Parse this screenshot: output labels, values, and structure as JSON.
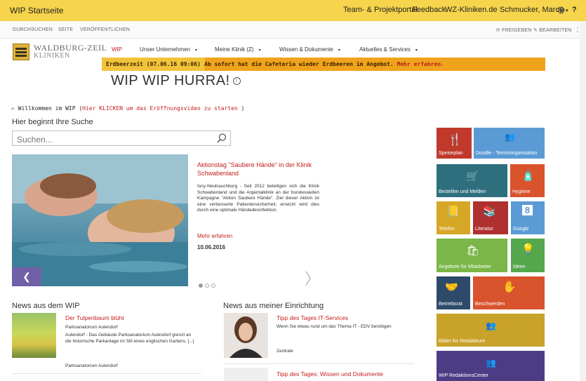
{
  "topbar": {
    "title": "WIP Startseite",
    "links": [
      "Team- & Projektportal",
      "Feedback",
      "WZ-Kliniken.de"
    ],
    "user": "Schmucker, Marco",
    "user_caret": "▾",
    "help": "?"
  },
  "ribbon": {
    "left": [
      "DURCHSUCHEN",
      "SEITE",
      "VERÖFFENTLICHEN"
    ],
    "share": "FREIGEBEN",
    "edit": "BEARBEITEN"
  },
  "logo": {
    "name": "WALDBURG-ZEIL",
    "sub": "KLINIKEN"
  },
  "nav": {
    "items": [
      "WIP",
      "Unser Unternehmen",
      "Meine Klinik (Z)",
      "Wissen & Dokumente",
      "Aktuelles & Services"
    ],
    "caret": "▾"
  },
  "announce": {
    "date": "Erdbeerzeit (07.06.16 09:06)",
    "message": "Ab sofort hat die Cafeteria wieder Erdbeeren im Angebot.",
    "more": "Mehr erfahren."
  },
  "page": {
    "title": "WIP WIP HURRA!",
    "info_icon": "i"
  },
  "welcome": {
    "text": "Willkommen im WIP (",
    "link": "Hier KLICKEN um das Eröffnungsvideo zu starten",
    "close": " )"
  },
  "search": {
    "heading": "Hier beginnt Ihre Suche",
    "placeholder": "Suchen..."
  },
  "carousel": {
    "prev": "❮",
    "next": "〉",
    "article": {
      "title": "Aktionstag \"Saubere Hände\" in der Klinik Schwabenland",
      "body": "Isny-Neutrauchburg - Seit 2012 beteiligen sich die Klinik Schwabenland und die Argentalklinik an der bundesweiten Kampagne \"Aktion Saubere Hände\". Ziel dieser Aktion ist eine verbesserte Patientensicherheit, erreicht wird dies durch eine optimale Händedesinfektion.",
      "more": "Mehr erfahren",
      "date": "10.06.2016"
    }
  },
  "news_wip": {
    "heading": "News aus dem WIP",
    "items": [
      {
        "title": "Der Tulpenbaum blüht",
        "location": "Parksanatorium Aulendorf",
        "text": "Aulendorf - Das Gebäude Parksanatorium Aulendorf grenzt an die historische Parkanlage im Stil eines englischen Gartens, [...]",
        "footer": "Parksanatorium Aulendorf"
      }
    ]
  },
  "news_facility": {
    "heading": "News aus meiner Einrichtung",
    "items": [
      {
        "title": "Tipp des Tages IT-Services",
        "text": "Wenn Sie etwas rund um das Thema IT - EDV benötigen",
        "footer": "Zentrale"
      },
      {
        "title": "Tipp des Tages: Wissen und Dokumente"
      }
    ]
  },
  "tiles": [
    {
      "label": "Speiseplan",
      "color": "#c0392b",
      "icon": "fork-knife-icon"
    },
    {
      "label": "Doodle - Terminorganisation",
      "color": "#5b9bd5",
      "icon": "people-icon"
    },
    {
      "label": "Bestellen und Melden",
      "color": "#2e6f7e",
      "icon": "cart-icon"
    },
    {
      "label": "Hygiene",
      "color": "#d9532c",
      "icon": "hygiene-icon"
    },
    {
      "label": "Telefon",
      "color": "#d6a726",
      "icon": "phone-book-icon"
    },
    {
      "label": "Literatur",
      "color": "#b03030",
      "icon": "books-icon"
    },
    {
      "label": "Google",
      "color": "#5b9bd5",
      "icon": "google-icon"
    },
    {
      "label": "Angebote für Mitarbeiter",
      "color": "#7ab648",
      "icon": "bag-icon"
    },
    {
      "label": "Ideen",
      "color": "#55a74c",
      "icon": "bulb-icon"
    },
    {
      "label": "Betriebsrat",
      "color": "#2e4a6b",
      "icon": "handshake-icon"
    },
    {
      "label": "Beschwerden",
      "color": "#d9532c",
      "icon": "hand-icon"
    },
    {
      "label": "Bilder für Redakteure",
      "color": "#c9a22a",
      "icon": "people-icon"
    },
    {
      "label": "WIP RedaktionsCenter",
      "color": "#4b3c84",
      "icon": "people-icon"
    }
  ]
}
